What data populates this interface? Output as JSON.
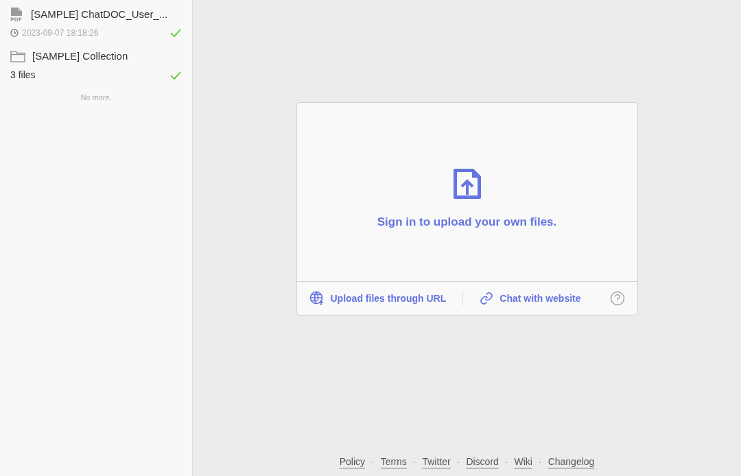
{
  "sidebar": {
    "items": [
      {
        "kind": "pdf",
        "file_type": "PDF",
        "title": "[SAMPLE] ChatDOC_User_...",
        "subtitle": "2023-09-07 18:18:26",
        "done": true
      },
      {
        "kind": "collection",
        "title": "[SAMPLE] Collection",
        "subtitle": "3 files",
        "done": true
      }
    ],
    "end_note": "No more."
  },
  "upload_card": {
    "message": "Sign in to upload your own files.",
    "actions": [
      {
        "kind": "url",
        "label": "Upload files through URL"
      },
      {
        "kind": "website",
        "label": "Chat with website"
      }
    ]
  },
  "footer": {
    "separator": "·",
    "links": [
      "Policy",
      "Terms",
      "Twitter",
      "Discord",
      "Wiki",
      "Changelog"
    ]
  }
}
